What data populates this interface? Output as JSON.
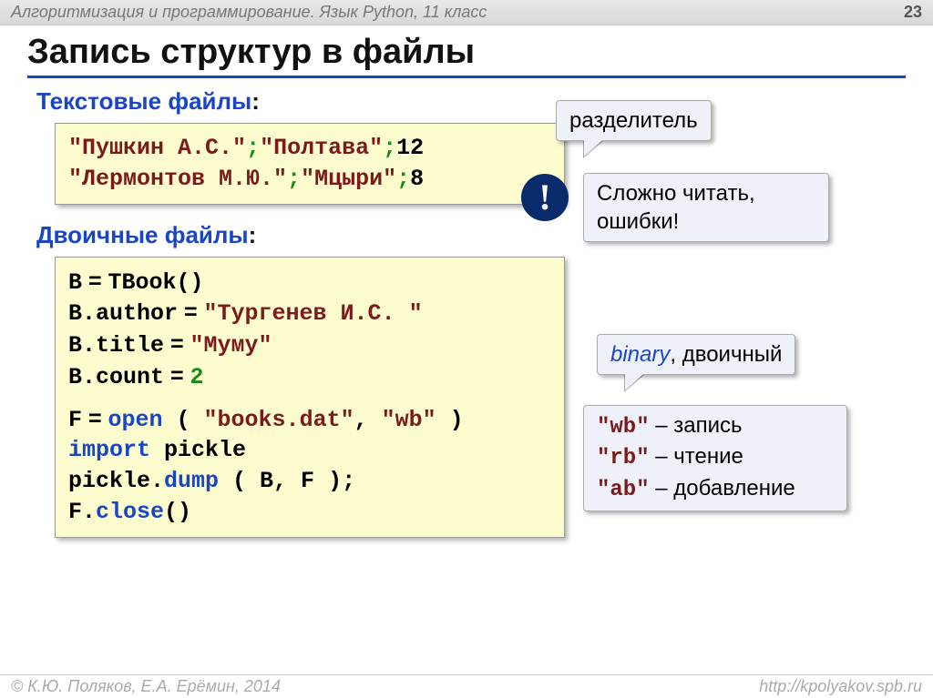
{
  "header": {
    "course": "Алгоритмизация и программирование. Язык Python, 11 класс",
    "pagenum": "23"
  },
  "title": "Запись структур в файлы",
  "text_section_label": "Текстовые файлы",
  "callout_delimiter": "разделитель",
  "code1_line1_a": "\"Пушкин А.С.\"",
  "code1_line1_b": "\"Полтава\"",
  "code1_line1_c": "12",
  "code1_line2_a": "\"Лермонтов М.Ю.\"",
  "code1_line2_b": "\"Мцыри\"",
  "code1_line2_c": "8",
  "semicolon": ";",
  "excl": "!",
  "callout_hard": "Сложно читать, ошибки!",
  "bin_section_label": "Двоичные файлы",
  "code2": {
    "l1_a": "B",
    "l1_b": "TBook()",
    "l2_a": "B.author",
    "l2_b": "\"Тургенев И.С. \"",
    "l3_a": "B.title",
    "l3_b": "\"Муму\"",
    "l4_a": "B.count",
    "l4_b": "2",
    "l5_a": "F",
    "l5_open": "open",
    "l5_b": " ( ",
    "l5_c": "\"books.dat\"",
    "l5_d": ", ",
    "l5_e": "\"wb\"",
    "l5_f": " )",
    "l6_import": "import",
    "l6_mod": " pickle",
    "l7_a": "pickle.",
    "l7_dump": "dump",
    "l7_b": " ( B, F );",
    "l8_a": "F.",
    "l8_close": "close",
    "l8_b": "()"
  },
  "eq": " = ",
  "callout_binary_it": "binary",
  "callout_binary_rest": ", двоичный",
  "modes": {
    "wb": "\"wb\"",
    "wb_t": " – запись",
    "rb": "\"rb\"",
    "rb_t": " – чтение",
    "ab": "\"ab\"",
    "ab_t": " – добавление"
  },
  "footer": {
    "authors": "© К.Ю. Поляков, Е.А. Ерёмин, 2014",
    "url": "http://kpolyakov.spb.ru"
  },
  "colon": ":"
}
